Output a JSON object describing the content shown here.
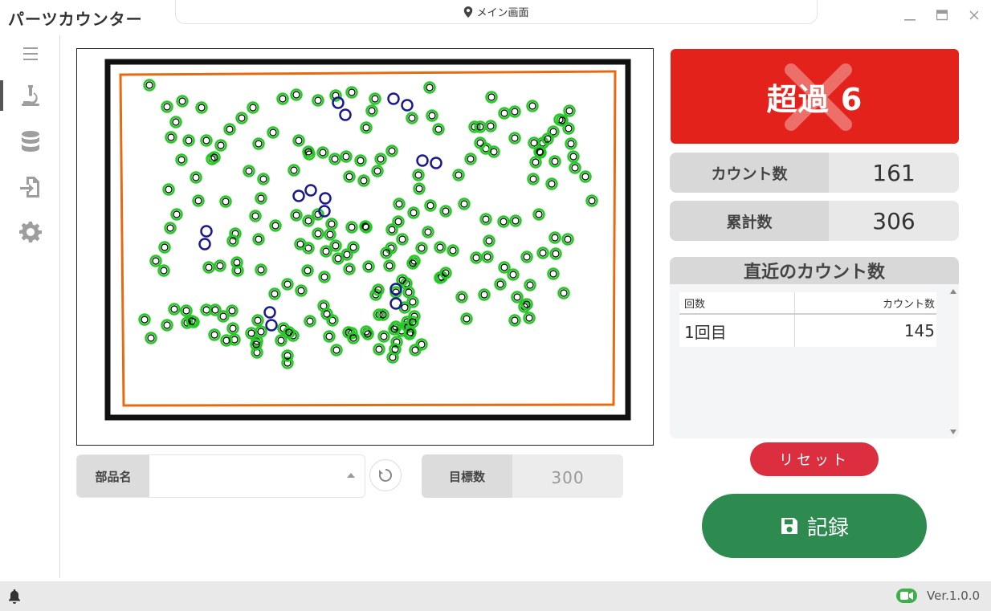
{
  "app": {
    "title": "パーツカウンター",
    "screen_name": "メイン画面"
  },
  "icons": {
    "location": "map-marker-icon",
    "menu": "hamburger-menu-icon",
    "count": "microscope-icon",
    "database": "database-icon",
    "import": "file-import-icon",
    "settings": "gear-icon",
    "reload": "reload-icon",
    "exceeded": "x-mark-icon",
    "save": "floppy-disk-icon",
    "bell": "bell-icon",
    "camera": "video-camera-icon"
  },
  "colors": {
    "alert_red": "#e3221b",
    "reset_red": "#db2f3f",
    "record_green": "#2e8b4f",
    "detected_green": "#22cc22",
    "detected_blue": "#1a1a8c",
    "tray_orange": "#e86a10",
    "camera_green": "#3cb04a"
  },
  "form": {
    "part_label": "部品名",
    "part_value": "",
    "target_label": "目標数",
    "target_value": "300"
  },
  "alert": {
    "text": "超過 6"
  },
  "stats": {
    "count_label": "カウント数",
    "count_value": "161",
    "total_label": "累計数",
    "total_value": "306"
  },
  "recent": {
    "title": "直近のカウント数",
    "columns": [
      "回数",
      "カウント数"
    ],
    "rows": [
      {
        "round": "1回目",
        "count": "145"
      }
    ]
  },
  "buttons": {
    "reset": "リセット",
    "record": "記録"
  },
  "status": {
    "version": "Ver.1.0.0"
  }
}
